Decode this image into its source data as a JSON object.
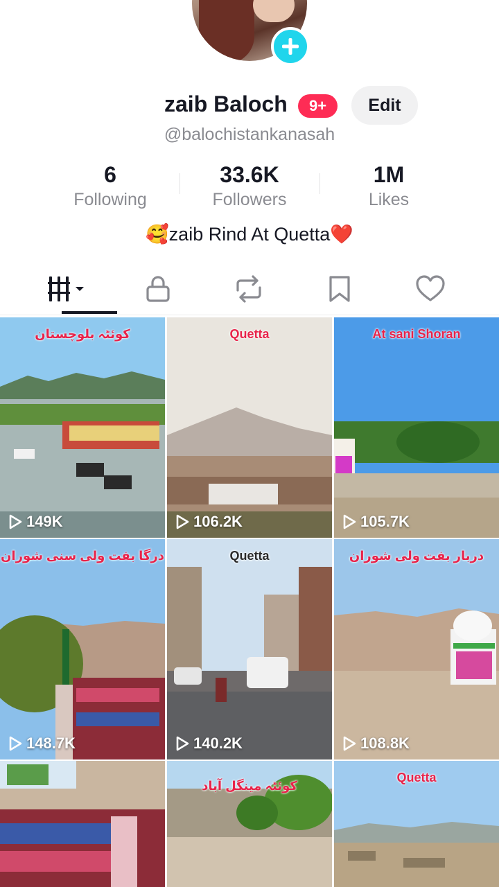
{
  "profile": {
    "display_name": "zaib Baloch",
    "notification_badge": "9+",
    "edit_label": "Edit",
    "handle": "@balochistankanasah",
    "bio": "🥰zaib Rind At Quetta❤️"
  },
  "stats": [
    {
      "value": "6",
      "label": "Following"
    },
    {
      "value": "33.6K",
      "label": "Followers"
    },
    {
      "value": "1M",
      "label": "Likes"
    }
  ],
  "tabs": [
    {
      "icon": "grid-icon",
      "active": true
    },
    {
      "icon": "lock-icon",
      "active": false
    },
    {
      "icon": "repost-icon",
      "active": false
    },
    {
      "icon": "bookmark-icon",
      "active": false
    },
    {
      "icon": "heart-icon",
      "active": false
    }
  ],
  "videos": [
    {
      "caption": "کوئٹہ بلوچستان",
      "views": "149K"
    },
    {
      "caption": "Quetta",
      "views": "106.2K"
    },
    {
      "caption": "At sani Shoran",
      "views": "105.7K"
    },
    {
      "caption": "درگا بفت ولی سنی شوران",
      "views": "148.7K"
    },
    {
      "caption": "Quetta",
      "views": "140.2K"
    },
    {
      "caption": "دربار بفت ولی شوران",
      "views": "108.8K"
    },
    {
      "caption": "",
      "views": ""
    },
    {
      "caption": "کوئٹہ مینگل آباد",
      "views": ""
    },
    {
      "caption": "Quetta",
      "views": ""
    }
  ],
  "colors": {
    "accent": "#fe2c55",
    "add_button": "#20d5ec",
    "caption_red": "#e8234a"
  }
}
